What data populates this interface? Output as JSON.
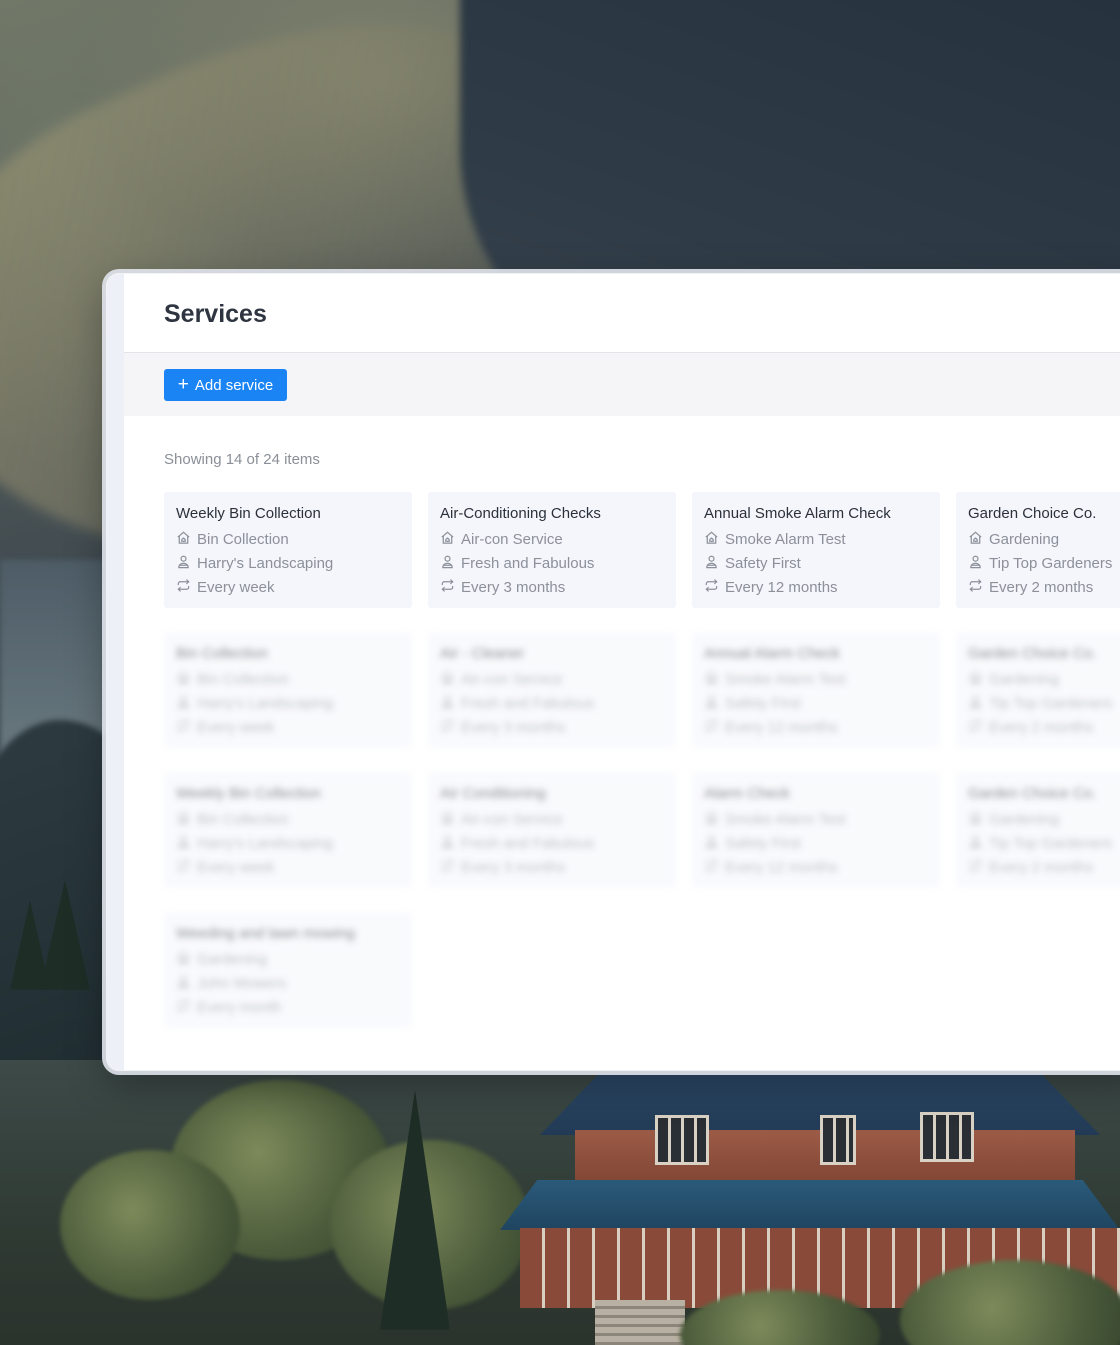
{
  "page": {
    "title": "Services",
    "add_button_label": "Add service",
    "count_text": "Showing 14 of 24 items"
  },
  "colors": {
    "accent": "#1a84f5",
    "card_bg": "#f5f6fb",
    "muted_text": "#8b909a"
  },
  "icons": {
    "category": "home-icon",
    "provider": "person-icon",
    "frequency": "repeat-icon",
    "add": "plus-icon"
  },
  "services": [
    {
      "title": "Weekly Bin Collection",
      "category": "Bin Collection",
      "provider": "Harry's Landscaping",
      "frequency": "Every week",
      "blurred": false
    },
    {
      "title": "Air-Conditioning Checks",
      "category": "Air-con Service",
      "provider": "Fresh and Fabulous",
      "frequency": "Every 3 months",
      "blurred": false
    },
    {
      "title": "Annual Smoke Alarm Check",
      "category": "Smoke Alarm Test",
      "provider": "Safety First",
      "frequency": "Every 12 months",
      "blurred": false
    },
    {
      "title": "Garden Choice Co.",
      "category": "Gardening",
      "provider": "Tip Top Gardeners",
      "frequency": "Every 2 months",
      "blurred": false
    },
    {
      "title": "Bin Collection",
      "category": "Bin Collection",
      "provider": "Harry's Landscaping",
      "frequency": "Every week",
      "blurred": true
    },
    {
      "title": "Air - Cleaner",
      "category": "Air-con Service",
      "provider": "Fresh and Fabulous",
      "frequency": "Every 3 months",
      "blurred": true
    },
    {
      "title": "Annual Alarm Check",
      "category": "Smoke Alarm Test",
      "provider": "Safety First",
      "frequency": "Every 12 months",
      "blurred": true
    },
    {
      "title": "Garden Choice Co.",
      "category": "Gardening",
      "provider": "Tip Top Gardeners",
      "frequency": "Every 2 months",
      "blurred": true
    },
    {
      "title": "Weekly Bin Collection",
      "category": "Bin Collection",
      "provider": "Harry's Landscaping",
      "frequency": "Every week",
      "blurred": true
    },
    {
      "title": "Air Conditioning",
      "category": "Air-con Service",
      "provider": "Fresh and Fabulous",
      "frequency": "Every 3 months",
      "blurred": true
    },
    {
      "title": "Alarm Check",
      "category": "Smoke Alarm Test",
      "provider": "Safety First",
      "frequency": "Every 12 months",
      "blurred": true
    },
    {
      "title": "Garden Choice Co.",
      "category": "Gardening",
      "provider": "Tip Top Gardeners",
      "frequency": "Every 2 months",
      "blurred": true
    },
    {
      "title": "Weeding and lawn mowing",
      "category": "Gardening",
      "provider": "John Mowers",
      "frequency": "Every month",
      "blurred": true
    }
  ]
}
